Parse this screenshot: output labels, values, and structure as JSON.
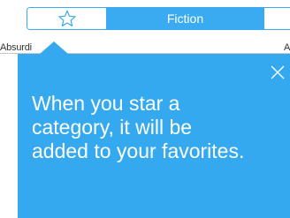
{
  "segmented_control": {
    "star_icon": "star-outline-icon",
    "fiction_label": "Fiction"
  },
  "background_list": {
    "left_text": "Absurdi",
    "right_text": "A"
  },
  "tooltip": {
    "close_icon": "close-icon",
    "message": "When you star a category, it will be added to your favorites."
  },
  "colors": {
    "accent": "#3aabf0",
    "popover": "#35a9ef"
  }
}
